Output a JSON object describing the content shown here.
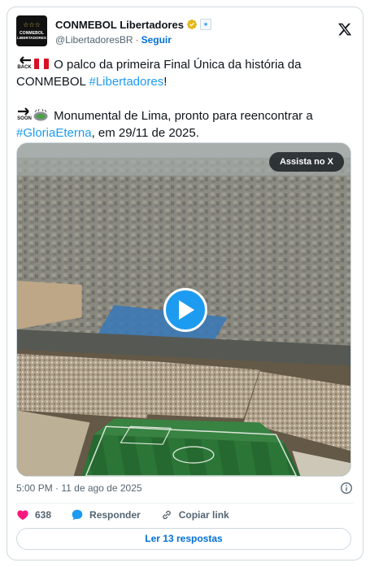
{
  "account": {
    "display_name": "CONMEBOL Libertadores",
    "handle": "@LibertadoresBR",
    "separator": "·",
    "follow_label": "Seguir",
    "avatar_text_top": "☆☆☆",
    "avatar_text_mid": "CONMEBOL",
    "avatar_text_bottom": "LIBERTADORES"
  },
  "tweet": {
    "back_label": "BACK",
    "soon_label": "SOON",
    "line1_text": " O palco da primeira Final Única da história da CONMEBOL ",
    "line1_hashtag": "#Libertadores",
    "line1_end": "!",
    "line2_text": " Monumental de Lima, pronto para reencontrar a ",
    "line2_hashtag": "#GloriaEterna",
    "line2_end": ", em 29/11 de 2025."
  },
  "media": {
    "watch_label": "Assista no X"
  },
  "meta": {
    "timestamp": "5:00 PM · 11 de ago de 2025"
  },
  "actions": {
    "like_count": "638",
    "reply_label": "Responder",
    "copy_label": "Copiar link"
  },
  "replies_button": "Ler 13 respostas",
  "colors": {
    "link": "#1d9bf0",
    "like": "#f91880",
    "muted": "#536471",
    "border": "#cfd9de"
  },
  "icons": [
    "verified-badge-icon",
    "affiliate-badge-icon",
    "x-logo-icon",
    "back-arrow-icon",
    "peru-flag-icon",
    "soon-arrow-icon",
    "stadium-icon",
    "play-icon",
    "info-icon",
    "heart-icon",
    "reply-bubble-icon",
    "link-icon"
  ]
}
